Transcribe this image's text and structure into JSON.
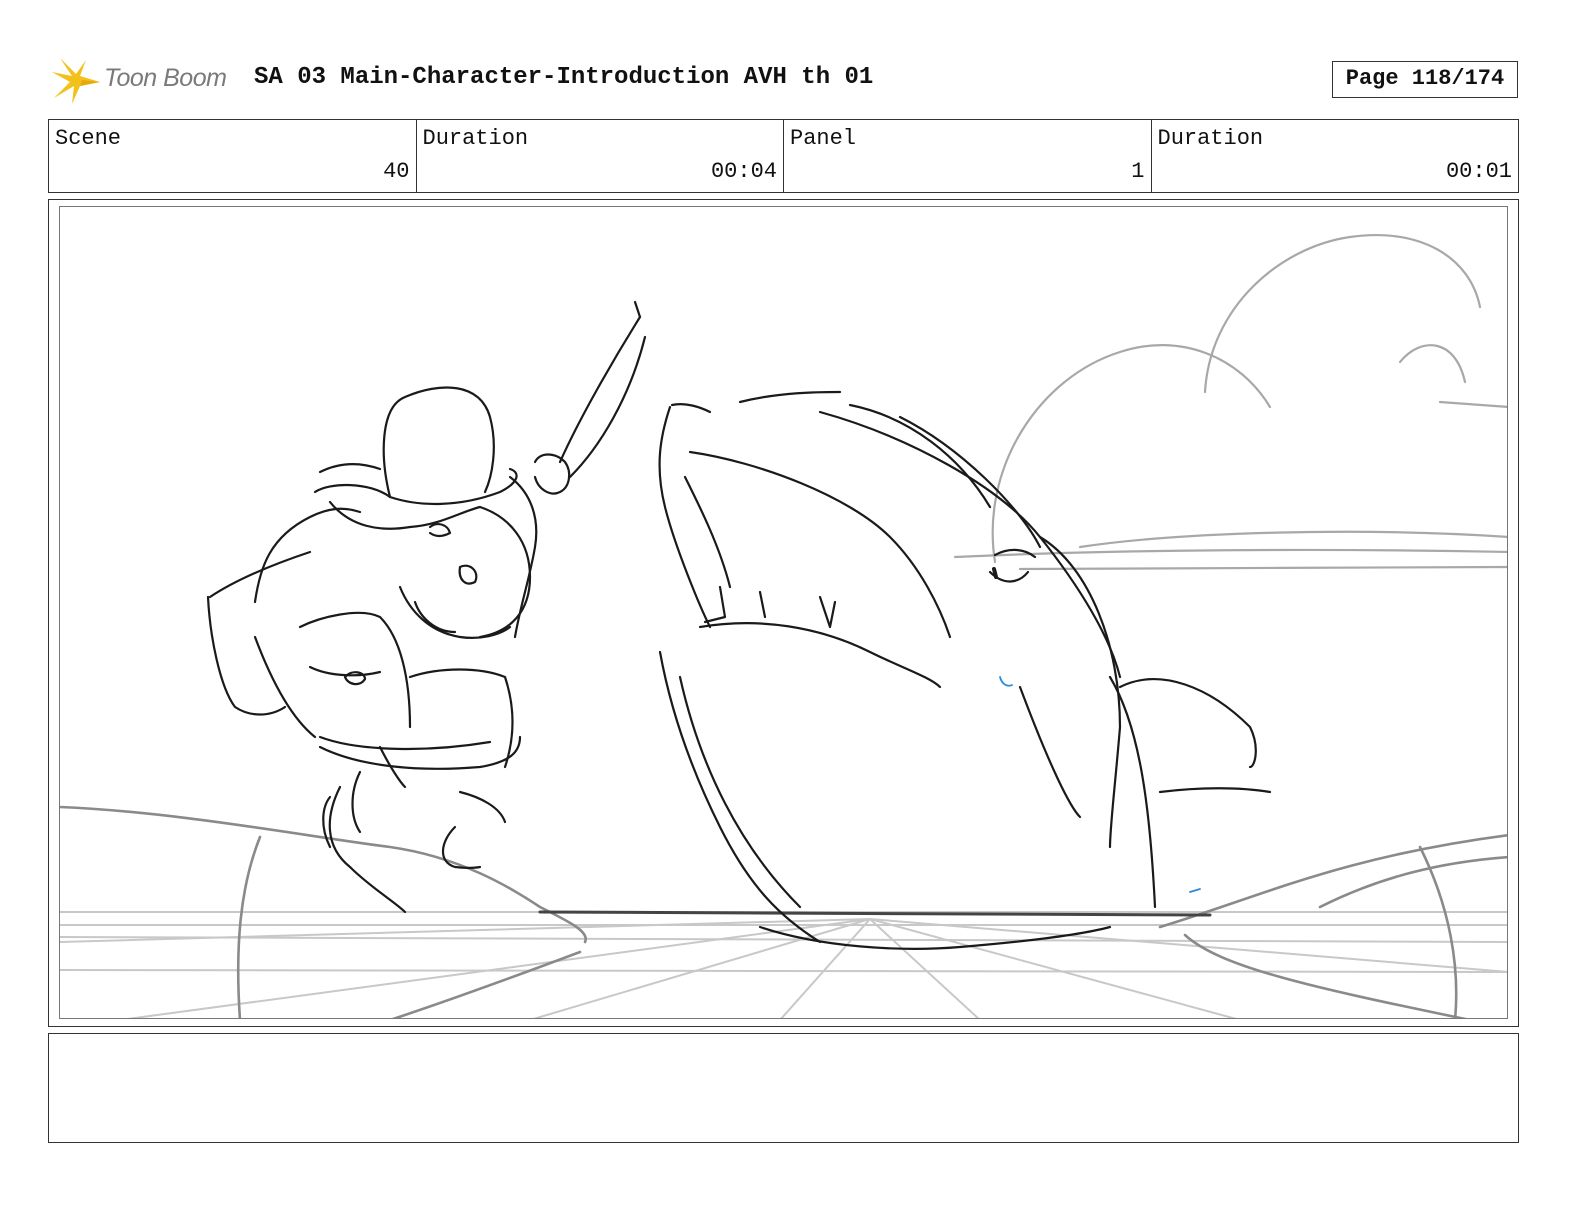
{
  "header": {
    "logo_text": "Toon Boom",
    "title": "SA 03 Main-Character-Introduction AVH th 01",
    "page": "Page 118/174"
  },
  "info": [
    {
      "label": "Scene",
      "value": "40"
    },
    {
      "label": "Duration",
      "value": "00:04"
    },
    {
      "label": "Panel",
      "value": "1"
    },
    {
      "label": "Duration",
      "value": "00:01"
    }
  ],
  "panel": {
    "icon": "storyboard-sketch",
    "content": "rough pencil sketch: character in bowler hat with raised knife leaping toward a large shark on the sea"
  },
  "notes": "",
  "colors": {
    "logo_yellow": "#f2c21a",
    "border": "#333333",
    "sketch_line": "#1a1a1a",
    "sketch_light": "#a8a8a8",
    "accent_blue": "#2a8ad8"
  }
}
